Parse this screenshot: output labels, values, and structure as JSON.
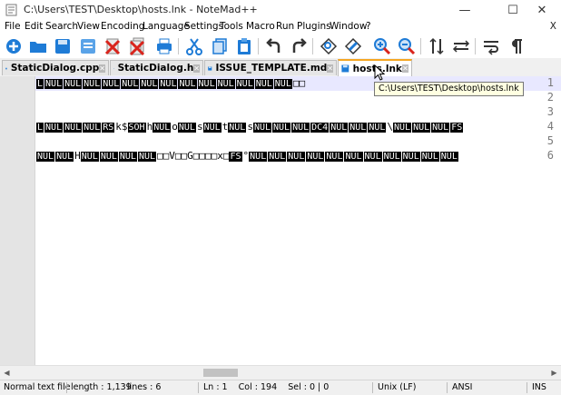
{
  "window": {
    "title": "C:\\Users\\TEST\\Desktop\\hosts.lnk - NoteMad++",
    "min_glyph": "—",
    "max_glyph": "☐",
    "close_glyph": "✕"
  },
  "menu": {
    "items": [
      "File",
      "Edit",
      "Search",
      "View",
      "Encoding",
      "Language",
      "Settings",
      "Tools",
      "Macro",
      "Run",
      "Plugins",
      "Window",
      "?"
    ],
    "close_x": "X"
  },
  "toolbar": {
    "icons": [
      "new-file-icon",
      "open-folder-icon",
      "save-icon",
      "save-all-icon",
      "close-icon",
      "close-all-icon",
      "print-icon",
      "cut-icon",
      "copy-icon",
      "paste-icon",
      "undo-icon",
      "redo-icon",
      "find-icon",
      "replace-icon",
      "zoom-in-icon",
      "zoom-out-icon",
      "sync-vertical-icon",
      "sync-horizontal-icon",
      "word-wrap-icon",
      "show-all-characters-icon"
    ]
  },
  "tabs": [
    {
      "label": "StaticDialog.cpp",
      "active": false
    },
    {
      "label": "StaticDialog.h",
      "active": false
    },
    {
      "label": "ISSUE_TEMPLATE.md",
      "active": false
    },
    {
      "label": "hosts.lnk",
      "active": true
    }
  ],
  "tooltip": "C:\\Users\\TEST\\Desktop\\hosts.lnk",
  "editor": {
    "line_numbers": [
      "1",
      "2",
      "3",
      "4",
      "5",
      "6"
    ],
    "lines": [
      [
        [
          "c",
          "L"
        ],
        [
          "c",
          "NUL"
        ],
        [
          "c",
          "NUL"
        ],
        [
          "c",
          "NUL"
        ],
        [
          "c",
          "NUL"
        ],
        [
          "c",
          "NUL"
        ],
        [
          "c",
          "NUL"
        ],
        [
          "c",
          "NUL"
        ],
        [
          "c",
          "NUL"
        ],
        [
          "c",
          "NUL"
        ],
        [
          "c",
          "NUL"
        ],
        [
          "c",
          "NUL"
        ],
        [
          "c",
          "NUL"
        ],
        [
          "c",
          "NUL"
        ],
        [
          "t",
          "□□"
        ]
      ],
      [],
      [],
      [
        [
          "c",
          "L"
        ],
        [
          "c",
          "NUL"
        ],
        [
          "c",
          "NUL"
        ],
        [
          "c",
          "NUL"
        ],
        [
          "c",
          "RS"
        ],
        [
          "t",
          "k$"
        ],
        [
          "c",
          "SOH"
        ],
        [
          "t",
          "h"
        ],
        [
          "c",
          "NUL"
        ],
        [
          "t",
          "o"
        ],
        [
          "c",
          "NUL"
        ],
        [
          "t",
          "s"
        ],
        [
          "c",
          "NUL"
        ],
        [
          "t",
          "t"
        ],
        [
          "c",
          "NUL"
        ],
        [
          "t",
          "s"
        ],
        [
          "c",
          "NUL"
        ],
        [
          "c",
          "NUL"
        ],
        [
          "c",
          "NUL"
        ],
        [
          "c",
          "DC4"
        ],
        [
          "c",
          "NUL"
        ],
        [
          "c",
          "NUL"
        ],
        [
          "c",
          "NUL"
        ],
        [
          "t",
          "\\"
        ],
        [
          "c",
          "NUL"
        ],
        [
          "c",
          "NUL"
        ],
        [
          "c",
          "NUL"
        ],
        [
          "c",
          "FS"
        ]
      ],
      [],
      [
        [
          "c",
          "NUL"
        ],
        [
          "c",
          "NUL"
        ],
        [
          "t",
          "H"
        ],
        [
          "c",
          "NUL"
        ],
        [
          "c",
          "NUL"
        ],
        [
          "c",
          "NUL"
        ],
        [
          "c",
          "NUL"
        ],
        [
          "t",
          "□□V□□G□□□□x□"
        ],
        [
          "c",
          "FS"
        ],
        [
          "t",
          "°"
        ],
        [
          "c",
          "NUL"
        ],
        [
          "c",
          "NUL"
        ],
        [
          "c",
          "NUL"
        ],
        [
          "c",
          "NUL"
        ],
        [
          "c",
          "NUL"
        ],
        [
          "c",
          "NUL"
        ],
        [
          "c",
          "NUL"
        ],
        [
          "c",
          "NUL"
        ],
        [
          "c",
          "NUL"
        ],
        [
          "c",
          "NUL"
        ],
        [
          "c",
          "NUL"
        ]
      ]
    ]
  },
  "status": {
    "file_type": "Normal text file",
    "length": "length : 1,139",
    "lines": "lines : 6",
    "position": "Ln : 1    Col : 194    Sel : 0 | 0",
    "eol": "Unix (LF)",
    "encoding": "ANSI",
    "mode": "INS"
  }
}
